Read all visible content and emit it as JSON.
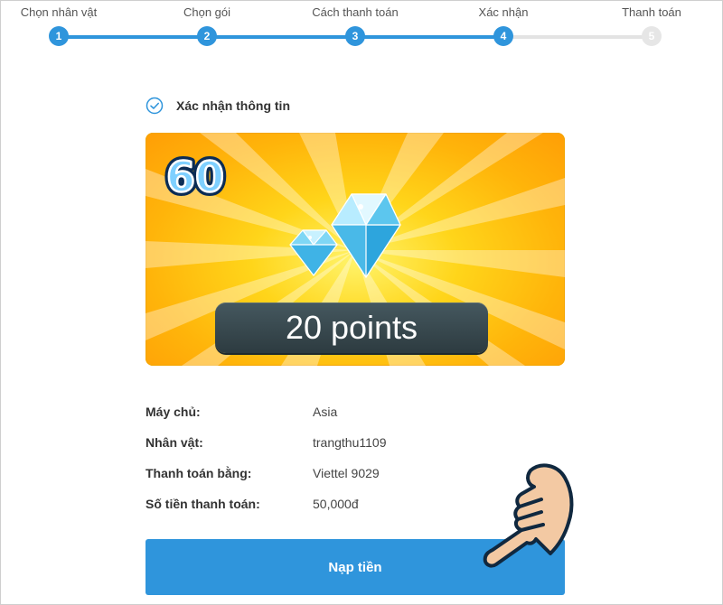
{
  "stepper": {
    "steps": [
      {
        "label": "Chọn nhân vật",
        "number": "1",
        "state": "done"
      },
      {
        "label": "Chọn gói",
        "number": "2",
        "state": "done"
      },
      {
        "label": "Cách thanh toán",
        "number": "3",
        "state": "done"
      },
      {
        "label": "Xác nhận",
        "number": "4",
        "state": "current"
      },
      {
        "label": "Thanh toán",
        "number": "5",
        "state": "todo"
      }
    ]
  },
  "confirm": {
    "title": "Xác nhận thông tin",
    "icon": "check-circle-icon"
  },
  "package": {
    "badge": "60",
    "points_label": "20 points",
    "image": "diamond-icon"
  },
  "details": [
    {
      "key": "Máy chủ:",
      "value": "Asia"
    },
    {
      "key": "Nhân vật:",
      "value": "trangthu1109"
    },
    {
      "key": "Thanh toán bằng:",
      "value": "Viettel 9029"
    },
    {
      "key": "Số tiền thanh toán:",
      "value": "50,000đ"
    }
  ],
  "submit_label": "Nạp tiền",
  "colors": {
    "accent": "#2f95dc",
    "inactive": "#e3e3e3",
    "card": "#ffc312"
  }
}
